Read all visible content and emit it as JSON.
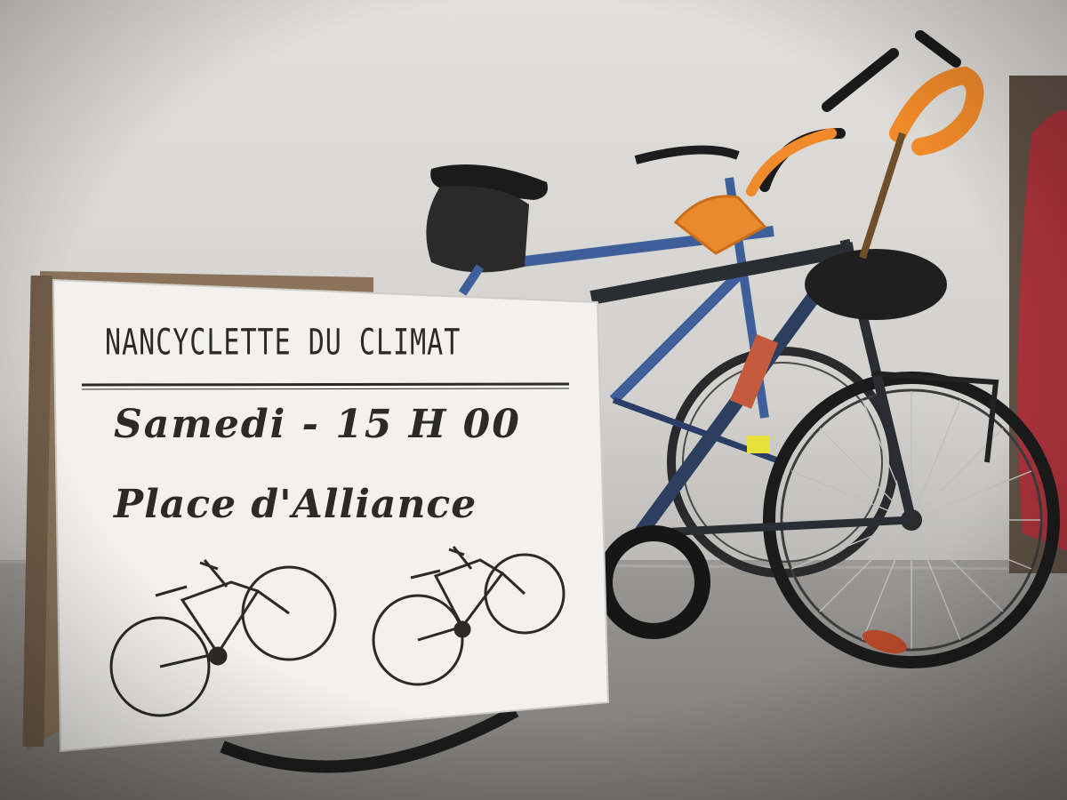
{
  "photo": {
    "subject": "bicycles-with-protest-sign",
    "colors": {
      "wall": "#d8d6d2",
      "floor": "#8e8c88",
      "sign_paper": "#f2f1ee",
      "ink": "#2b2a28",
      "bar_tape": "#f08a2a",
      "blue_frame": "#3f5f9a",
      "red_object": "#a8323a"
    }
  },
  "sign": {
    "title": "NANCYCLETTE DU CLIMAT",
    "line1": "Samedi - 15 H 00",
    "line2": "Place d'Alliance",
    "illustrations": [
      "vintage-bicycle-illustration",
      "vintage-bicycle-illustration"
    ]
  }
}
